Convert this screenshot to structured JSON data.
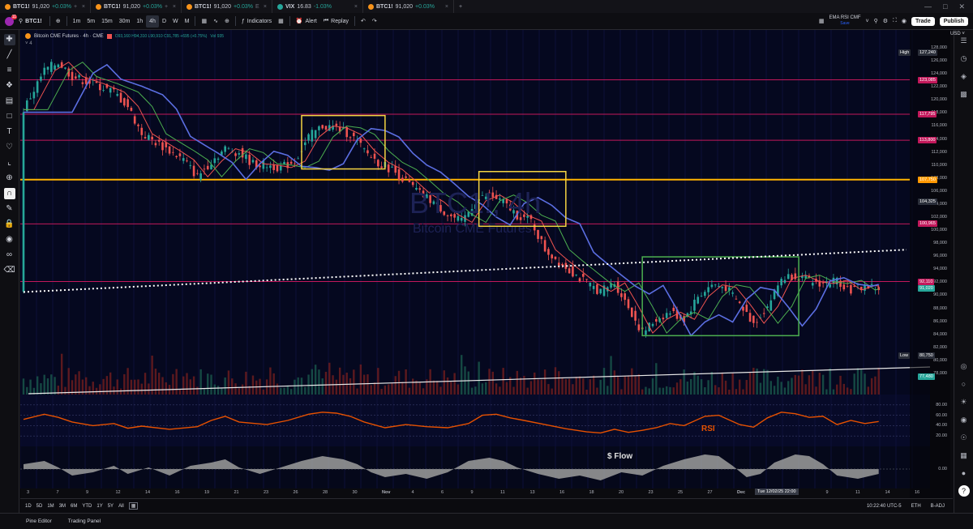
{
  "tabs": [
    {
      "symbol": "BTC1!",
      "price": "91,020",
      "change": "+0.03%",
      "tail": "+",
      "icon": "btc"
    },
    {
      "symbol": "BTC1!",
      "price": "91,020",
      "change": "+0.03%",
      "tail": "+",
      "icon": "btc"
    },
    {
      "symbol": "BTC1!",
      "price": "91,020",
      "change": "+0.03%",
      "tail": "E",
      "icon": "btc"
    },
    {
      "symbol": "VIX",
      "price": "16.83",
      "change": "-1.03%",
      "tail": "",
      "icon": "vix"
    },
    {
      "symbol": "BTC1!",
      "price": "91,020",
      "change": "+0.03%",
      "tail": "",
      "icon": "btc"
    }
  ],
  "toolbar": {
    "symbol": "BTC1!",
    "intervals": [
      "1m",
      "5m",
      "15m",
      "30m",
      "1h",
      "4h",
      "D",
      "W",
      "M"
    ],
    "active_interval": "4h",
    "indicators_label": "Indicators",
    "alert_label": "Alert",
    "replay_label": "Replay",
    "layout_name": "EMA RSI CMF",
    "layout_sub": "Save",
    "trade_label": "Trade",
    "publish_label": "Publish",
    "notif_count": "11"
  },
  "legend": {
    "title": "Bitcoin CME Futures · 4h · CME",
    "ohlc": "O93,160 H94,310 L90,910 C91,785 +695 (+0.75%)",
    "vol": "Vol 935",
    "indicator_count": "4"
  },
  "watermark": {
    "main": "BTC1!, 4h",
    "sub": "Bitcoin CME Futures"
  },
  "price_axis": {
    "currency": "USD",
    "ticks": [
      "128,000",
      "126,000",
      "124,000",
      "122,000",
      "120,000",
      "118,000",
      "116,000",
      "114,000",
      "112,000",
      "110,000",
      "108,000",
      "106,000",
      "104,000",
      "102,000",
      "100,000",
      "98,000",
      "96,000",
      "94,000",
      "92,000",
      "90,000",
      "88,000",
      "86,000",
      "84,000",
      "82,000",
      "80,000",
      "78,000"
    ],
    "high_label": "High",
    "high_value": "127,240",
    "low_label": "Low",
    "low_value": "80,750",
    "level_tags": [
      "123,085",
      "117,795",
      "113,800",
      "107,750",
      "104,325",
      "100,965",
      "92,110",
      "91,020",
      "77,480"
    ]
  },
  "rsi_axis": [
    "80.00",
    "60.00",
    "40.00",
    "20.00"
  ],
  "flow_axis": [
    "0.00"
  ],
  "pane_labels": {
    "rsi": "RSI",
    "flow": "$ Flow"
  },
  "time_axis": {
    "labels": [
      "3",
      "7",
      "9",
      "12",
      "14",
      "16",
      "19",
      "21",
      "23",
      "26",
      "28",
      "30",
      "Nov",
      "4",
      "6",
      "9",
      "11",
      "13",
      "16",
      "18",
      "20",
      "23",
      "25",
      "27",
      "Dec",
      "3",
      "5",
      "9",
      "11",
      "14",
      "16"
    ],
    "crosshair": "Tue 12/02/25   22:00"
  },
  "range_bar": {
    "ranges": [
      "1D",
      "5D",
      "1M",
      "3M",
      "6M",
      "YTD",
      "1Y",
      "5Y",
      "All"
    ],
    "clock": "10:22:40 UTC-5",
    "session": "ETH",
    "adj": "B-ADJ"
  },
  "bottom_bar": {
    "pine": "Pine Editor",
    "panel": "Trading Panel"
  },
  "colors": {
    "background": "#05081f",
    "up": "#26a69a",
    "down": "#ef5350",
    "ema_fast": "#ef5350",
    "ema_mid": "#4caf50",
    "ema_slow": "#5b6ee1",
    "box_yellow": "#f5d442",
    "box_green": "#4caf50",
    "line_orange": "#ffb300",
    "line_magenta": "#c2185b",
    "rsi": "#e65100"
  },
  "chart_data": {
    "type": "candlestick",
    "title": "Bitcoin CME Futures · 4h · CME",
    "ylim": [
      77000,
      128500
    ],
    "close_path": [
      [
        0,
        118500
      ],
      [
        6,
        124500
      ],
      [
        10,
        125800
      ],
      [
        14,
        123600
      ],
      [
        20,
        122500
      ],
      [
        26,
        121200
      ],
      [
        30,
        119000
      ],
      [
        34,
        114800
      ],
      [
        38,
        113500
      ],
      [
        42,
        112200
      ],
      [
        46,
        110800
      ],
      [
        50,
        108200
      ],
      [
        54,
        110600
      ],
      [
        58,
        112500
      ],
      [
        62,
        111900
      ],
      [
        66,
        110200
      ],
      [
        70,
        110000
      ],
      [
        74,
        109600
      ],
      [
        78,
        110600
      ],
      [
        82,
        114300
      ],
      [
        86,
        116000
      ],
      [
        90,
        115700
      ],
      [
        94,
        114700
      ],
      [
        98,
        112200
      ],
      [
        102,
        110400
      ],
      [
        106,
        109300
      ],
      [
        110,
        107500
      ],
      [
        114,
        105600
      ],
      [
        118,
        104300
      ],
      [
        122,
        102400
      ],
      [
        126,
        101200
      ],
      [
        130,
        104500
      ],
      [
        134,
        105400
      ],
      [
        138,
        104200
      ],
      [
        142,
        102300
      ],
      [
        146,
        101400
      ],
      [
        150,
        97000
      ],
      [
        154,
        95200
      ],
      [
        158,
        93500
      ],
      [
        162,
        91800
      ],
      [
        166,
        90600
      ],
      [
        170,
        91900
      ],
      [
        174,
        88200
      ],
      [
        178,
        84200
      ],
      [
        182,
        86300
      ],
      [
        186,
        87400
      ],
      [
        190,
        86300
      ],
      [
        194,
        89800
      ],
      [
        198,
        91600
      ],
      [
        202,
        91200
      ],
      [
        206,
        88600
      ],
      [
        210,
        85700
      ],
      [
        214,
        88300
      ],
      [
        218,
        92600
      ],
      [
        222,
        93100
      ],
      [
        226,
        92100
      ],
      [
        230,
        91800
      ],
      [
        234,
        92300
      ],
      [
        238,
        90800
      ],
      [
        242,
        91500
      ],
      [
        246,
        91020
      ]
    ],
    "horizontal_levels": [
      {
        "value": 123085,
        "color": "#c2185b"
      },
      {
        "value": 117795,
        "color": "#c2185b"
      },
      {
        "value": 113800,
        "color": "#c2185b"
      },
      {
        "value": 107750,
        "color": "#ffb300"
      },
      {
        "value": 100965,
        "color": "#c2185b"
      },
      {
        "value": 92110,
        "color": "#c2185b"
      }
    ],
    "boxes": [
      {
        "x0": 80,
        "x1": 104,
        "y0": 109400,
        "y1": 117600,
        "color": "#f5d442"
      },
      {
        "x0": 131,
        "x1": 156,
        "y0": 100600,
        "y1": 109000,
        "color": "#f5d442"
      },
      {
        "x0": 178,
        "x1": 223,
        "y0": 83800,
        "y1": 95900,
        "color": "#4caf50"
      }
    ],
    "trendline": {
      "x0": 0,
      "y0": 90500,
      "x1": 254,
      "y1": 97000,
      "style": "dotted"
    },
    "rsi_path": [
      [
        0,
        52
      ],
      [
        6,
        62
      ],
      [
        10,
        56
      ],
      [
        14,
        47
      ],
      [
        20,
        40
      ],
      [
        26,
        44
      ],
      [
        30,
        35
      ],
      [
        34,
        39
      ],
      [
        42,
        33
      ],
      [
        50,
        38
      ],
      [
        54,
        50
      ],
      [
        58,
        58
      ],
      [
        62,
        47
      ],
      [
        70,
        42
      ],
      [
        76,
        50
      ],
      [
        82,
        62
      ],
      [
        86,
        66
      ],
      [
        90,
        64
      ],
      [
        94,
        58
      ],
      [
        98,
        47
      ],
      [
        104,
        36
      ],
      [
        110,
        42
      ],
      [
        116,
        38
      ],
      [
        122,
        36
      ],
      [
        128,
        44
      ],
      [
        132,
        60
      ],
      [
        136,
        62
      ],
      [
        140,
        55
      ],
      [
        144,
        50
      ],
      [
        150,
        42
      ],
      [
        156,
        34
      ],
      [
        162,
        28
      ],
      [
        166,
        26
      ],
      [
        170,
        33
      ],
      [
        174,
        27
      ],
      [
        178,
        31
      ],
      [
        182,
        36
      ],
      [
        186,
        44
      ],
      [
        190,
        40
      ],
      [
        196,
        58
      ],
      [
        200,
        60
      ],
      [
        206,
        42
      ],
      [
        210,
        37
      ],
      [
        214,
        55
      ],
      [
        218,
        66
      ],
      [
        222,
        63
      ],
      [
        226,
        56
      ],
      [
        230,
        58
      ],
      [
        234,
        42
      ],
      [
        238,
        50
      ],
      [
        242,
        44
      ],
      [
        246,
        48
      ]
    ],
    "flow_path": [
      [
        0,
        0.3
      ],
      [
        6,
        0.5
      ],
      [
        10,
        0.1
      ],
      [
        14,
        -0.4
      ],
      [
        20,
        -0.2
      ],
      [
        26,
        0.2
      ],
      [
        30,
        -0.3
      ],
      [
        36,
        0.1
      ],
      [
        42,
        -0.4
      ],
      [
        48,
        0.2
      ],
      [
        54,
        0.4
      ],
      [
        58,
        0.6
      ],
      [
        62,
        0.1
      ],
      [
        68,
        -0.3
      ],
      [
        74,
        0.1
      ],
      [
        80,
        0.5
      ],
      [
        86,
        0.8
      ],
      [
        92,
        0.6
      ],
      [
        96,
        0.3
      ],
      [
        100,
        -0.2
      ],
      [
        104,
        -0.5
      ],
      [
        110,
        -0.3
      ],
      [
        116,
        -0.6
      ],
      [
        122,
        -0.2
      ],
      [
        128,
        0.5
      ],
      [
        134,
        0.7
      ],
      [
        138,
        0.5
      ],
      [
        142,
        0.1
      ],
      [
        148,
        -0.3
      ],
      [
        154,
        -0.6
      ],
      [
        160,
        -0.4
      ],
      [
        166,
        -0.7
      ],
      [
        172,
        -0.2
      ],
      [
        178,
        -0.4
      ],
      [
        184,
        0.2
      ],
      [
        190,
        0.6
      ],
      [
        196,
        0.9
      ],
      [
        200,
        0.8
      ],
      [
        204,
        0.2
      ],
      [
        208,
        -0.5
      ],
      [
        212,
        -0.3
      ],
      [
        216,
        0.4
      ],
      [
        222,
        0.9
      ],
      [
        226,
        0.8
      ],
      [
        230,
        0.3
      ],
      [
        234,
        -0.4
      ],
      [
        240,
        -0.6
      ],
      [
        246,
        -0.3
      ]
    ]
  }
}
